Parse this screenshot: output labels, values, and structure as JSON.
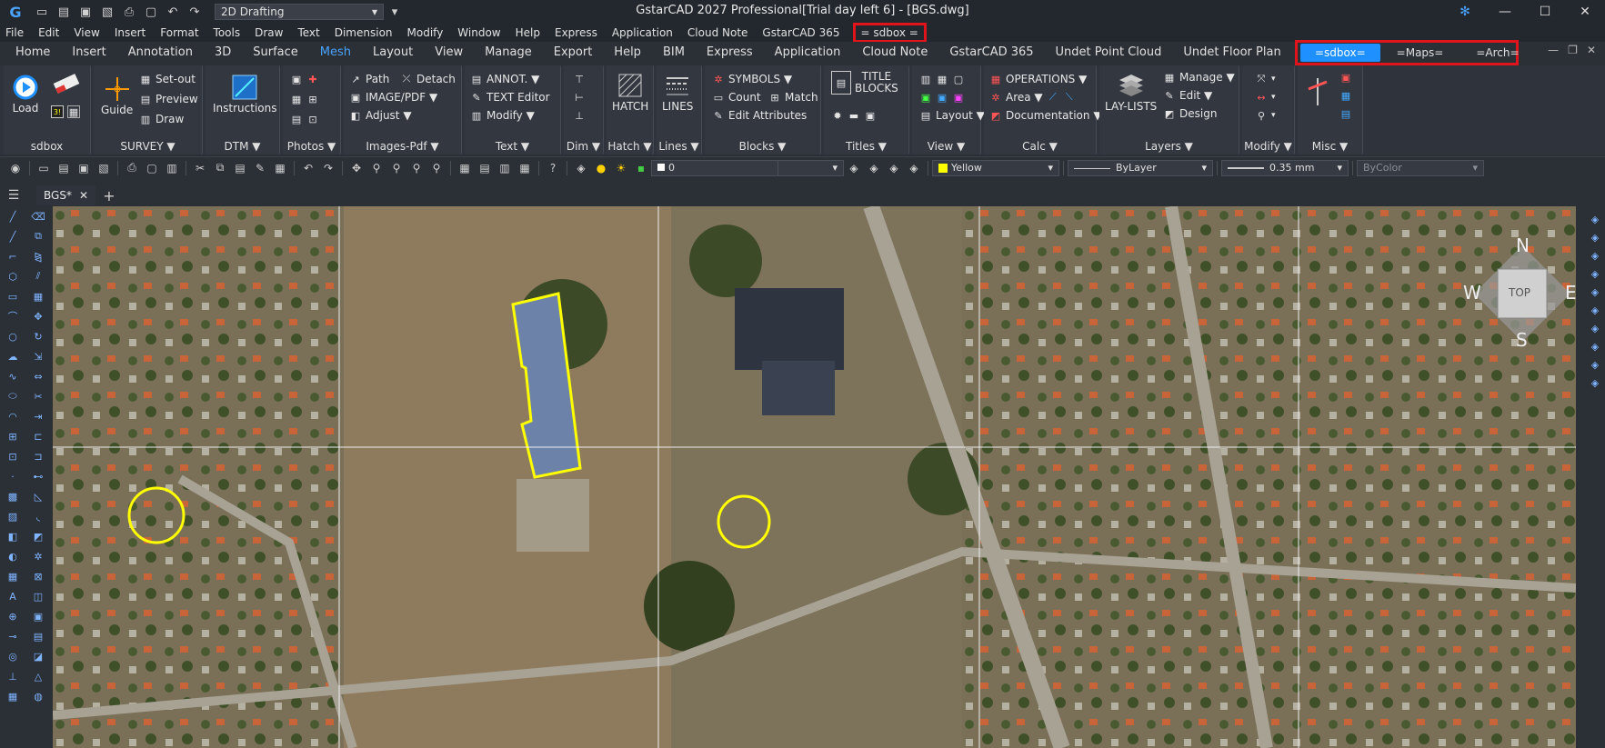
{
  "titlebar": {
    "title": "GstarCAD 2027 Professional[Trial day left 6] - [BGS.dwg]",
    "workspace": "2D Drafting",
    "app_logo": "G"
  },
  "menu": {
    "items": [
      "File",
      "Edit",
      "View",
      "Insert",
      "Format",
      "Tools",
      "Draw",
      "Text",
      "Dimension",
      "Modify",
      "Window",
      "Help",
      "Express",
      "Application",
      "Cloud Note",
      "GstarCAD 365"
    ],
    "highlighted": "= sdbox ="
  },
  "ribbon_tabs": {
    "items": [
      "Home",
      "Insert",
      "Annotation",
      "3D",
      "Surface",
      "Mesh",
      "Layout",
      "View",
      "Manage",
      "Export",
      "Help",
      "BIM",
      "Express",
      "Application",
      "Cloud Note",
      "GstarCAD 365",
      "Undet Point Cloud",
      "Undet Floor Plan"
    ],
    "active": "Mesh",
    "highlighted": [
      "=sdbox=",
      "=Maps=",
      "=Arch="
    ]
  },
  "ribbon": {
    "sdbox": {
      "title": "sdbox",
      "load": "Load"
    },
    "survey": {
      "title": "SURVEY ▼",
      "guide": "Guide",
      "setout": "Set-out",
      "preview": "Preview",
      "draw": "Draw"
    },
    "dtm": {
      "title": "DTM ▼",
      "instructions": "Instructions"
    },
    "photos": {
      "title": "Photos ▼"
    },
    "images": {
      "title": "Images-Pdf ▼",
      "path": "Path",
      "detach": "Detach",
      "imagepdf": "IMAGE/PDF ▼",
      "adjust": "Adjust ▼"
    },
    "text": {
      "title": "Text ▼",
      "annot": "ANNOT. ▼",
      "textedit": "TEXT Editor",
      "modify": "Modify ▼"
    },
    "dim": {
      "title": "Dim ▼"
    },
    "hatch": {
      "title": "Hatch ▼",
      "label": "HATCH"
    },
    "lines": {
      "title": "Lines ▼",
      "label": "LINES"
    },
    "blocks": {
      "title": "Blocks ▼",
      "symbols": "SYMBOLS ▼",
      "count": "Count",
      "match": "Match",
      "editattr": "Edit Attributes"
    },
    "titles": {
      "title": "Titles ▼",
      "label1": "TITLE",
      "label2": "BLOCKS"
    },
    "view": {
      "title": "View ▼",
      "layout": "Layout ▼"
    },
    "calc": {
      "title": "Calc ▼",
      "operations": "OPERATIONS ▼",
      "area": "Area ▼",
      "documentation": "Documentation ▼"
    },
    "layers": {
      "title": "Layers ▼",
      "laylists": "LAY-LISTS",
      "manage": "Manage ▼",
      "edit": "Edit ▼",
      "design": "Design"
    },
    "modify": {
      "title": "Modify ▼"
    },
    "misc": {
      "title": "Misc ▼"
    }
  },
  "toolbar": {
    "layer": "0",
    "color": "Yellow",
    "linetype": "ByLayer",
    "lineweight": "0.35 mm",
    "plotstyle": "ByColor"
  },
  "doc_tabs": {
    "active": "BGS*"
  },
  "viewcube": {
    "n": "N",
    "s": "S",
    "e": "E",
    "w": "W",
    "top": "TOP"
  },
  "colors": {
    "accent": "#1e90ff",
    "highlight_box": "#e0141a",
    "selection": "#ffff00"
  }
}
